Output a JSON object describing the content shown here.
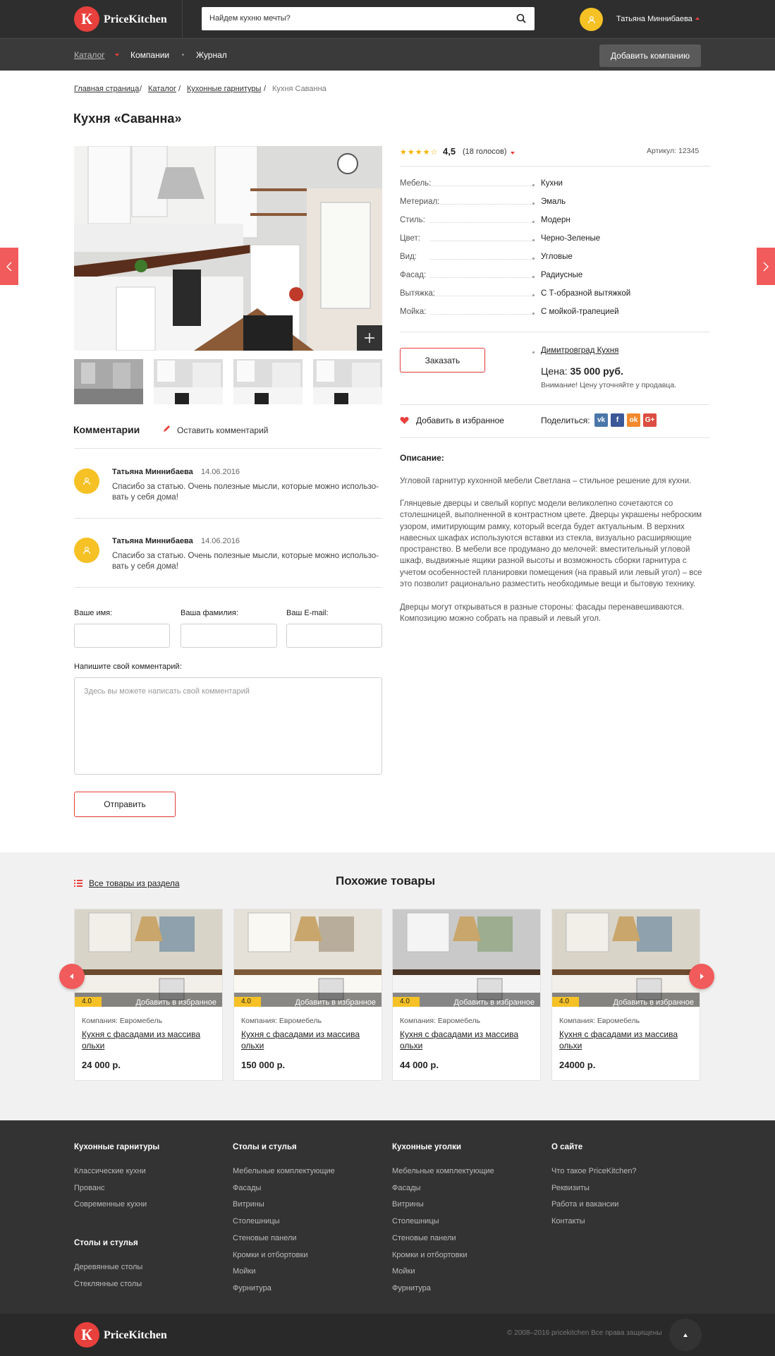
{
  "header": {
    "logo_letter": "К",
    "logo_text": "PriceKitchen",
    "search_placeholder": "Найдем кухню мечты?",
    "user_name": "Татьяна Миннибаева"
  },
  "nav": {
    "items": [
      "Каталог",
      "Компании",
      "Журнал"
    ],
    "add_company": "Добавить компанию"
  },
  "breadcrumb": [
    "Главная страница",
    "Каталог",
    "Кухонные гарнитуры",
    "Кухня Саванна"
  ],
  "title": "Кухня «Саванна»",
  "product": {
    "rating": "4,5",
    "votes": "(18 голосов)",
    "article": "Артикул: 12345",
    "specs": [
      {
        "label": "Мебель:",
        "value": "Кухни"
      },
      {
        "label": "Метериал:",
        "value": "Эмаль"
      },
      {
        "label": "Стиль:",
        "value": "Модерн"
      },
      {
        "label": "Цвет:",
        "value": "Черно-Зеленые"
      },
      {
        "label": "Вид:",
        "value": "Угловые"
      },
      {
        "label": "Фасад:",
        "value": "Радиусные"
      },
      {
        "label": "Вытяжка:",
        "value": "С Т-образной вытяжкой"
      },
      {
        "label": "Мойка:",
        "value": "С мойкой-трапецией"
      }
    ],
    "order_button": "Заказать",
    "seller": "Димитровград Кухня",
    "price_label": "Цена:",
    "price_value": "35 000 руб.",
    "price_note": "Внимание! Цену уточняйте у продавца.",
    "add_favorite": "Добавить в избранное",
    "share_label": "Поделиться:",
    "social": [
      "vk",
      "f",
      "ok",
      "G+"
    ],
    "description_title": "Описание:",
    "description": [
      "Угловой гарнитур кухонной мебели Светлана – стильное решение для кухни.",
      "Глянцевые дверцы и свелый корпус модели великолепно сочетаются со столешницей, выполненной в контрастном цвете. Дверцы украшены неброским узором, имитирующим рамку, который всегда будет актуальным. В верхних навесных шкафах используются вставки из стекла, визуально расширяющие пространство. В мебели все продумано до мелочей: вместительный угловой шкаф, выдвижные ящики разной высоты и возможность сборки гарнитура с учетом особенностей планировки помещения (на правый или левый угол) – все это позволит рационально разместить необходимые вещи и бытовую технику.",
      "Дверцы могут открываться в разные стороны: фасады перенавешиваются. Композицию можно собрать на правый и левый угол."
    ]
  },
  "comments": {
    "title": "Комментарии",
    "leave": "Оставить комментарий",
    "items": [
      {
        "name": "Татьяна Миннибаева",
        "date": "14.06.2016",
        "text": "Спасибо за статью. Очень полезные мысли, которые можно использо-вать у себя дома!"
      },
      {
        "name": "Татьяна Миннибаева",
        "date": "14.06.2016",
        "text": "Спасибо за статью. Очень полезные мысли, которые можно использо-вать у себя дома!"
      }
    ],
    "form": {
      "name_label": "Ваше имя:",
      "surname_label": "Ваша фамилия:",
      "email_label": "Ваш E-mail:",
      "comment_label": "Напишите свой комментарий:",
      "comment_placeholder": "Здесь вы можете написать свой комментарий",
      "submit": "Отправить"
    }
  },
  "similar": {
    "all_link": "Все товары из раздела",
    "title": "Похожие товары",
    "cards": [
      {
        "rating": "4.0",
        "fav": "Добавить в избранное",
        "company": "Компания: Евромебель",
        "name": "Кухня с фасадами из массива ольхи",
        "price": "24 000 р."
      },
      {
        "rating": "4.0",
        "fav": "Добавить в избранное",
        "company": "Компания: Евромебель",
        "name": "Кухня с фасадами из массива ольхи",
        "price": "150 000 р."
      },
      {
        "rating": "4.0",
        "fav": "Добавить в избранное",
        "company": "Компания: Евромебель",
        "name": "Кухня с фасадами из массива ольхи",
        "price": "44 000 р."
      },
      {
        "rating": "4.0",
        "fav": "Добавить в избранное",
        "company": "Компания: Евромебель",
        "name": "Кухня с фасадами из массива ольхи",
        "price": "24000 р."
      }
    ]
  },
  "footer": {
    "columns": [
      {
        "title": "Кухонные гарнитуры",
        "links": [
          "Классические кухни",
          "Прованс",
          "Современные кухни"
        ]
      },
      {
        "title": "Столы и стулья",
        "links": [
          "Мебельные комплектующие",
          "Фасады",
          "Витрины",
          "Столешницы",
          "Стеновые панели",
          "Кромки и отбортовки",
          "Мойки",
          "Фурнитура"
        ]
      },
      {
        "title": "Кухонные уголки",
        "links": [
          "Мебельные комплектующие",
          "Фасады",
          "Витрины",
          "Столешницы",
          "Стеновые панели",
          "Кромки и отбортовки",
          "Мойки",
          "Фурнитура"
        ]
      },
      {
        "title": "О сайте",
        "links": [
          "Что такое PriceKitchen?",
          "Реквизиты",
          "Работа и вакансии",
          "Контакты"
        ]
      }
    ],
    "extra": {
      "title": "Столы и стулья",
      "links": [
        "Деревянные столы",
        "Стеклянные столы"
      ]
    },
    "copyright": "© 2008–2016 pricekitchen Все права защищены"
  },
  "colors": {
    "accent": "#e8403c",
    "star": "#f5b301",
    "avatar": "#f5c125",
    "dark": "#2e2e2e"
  }
}
